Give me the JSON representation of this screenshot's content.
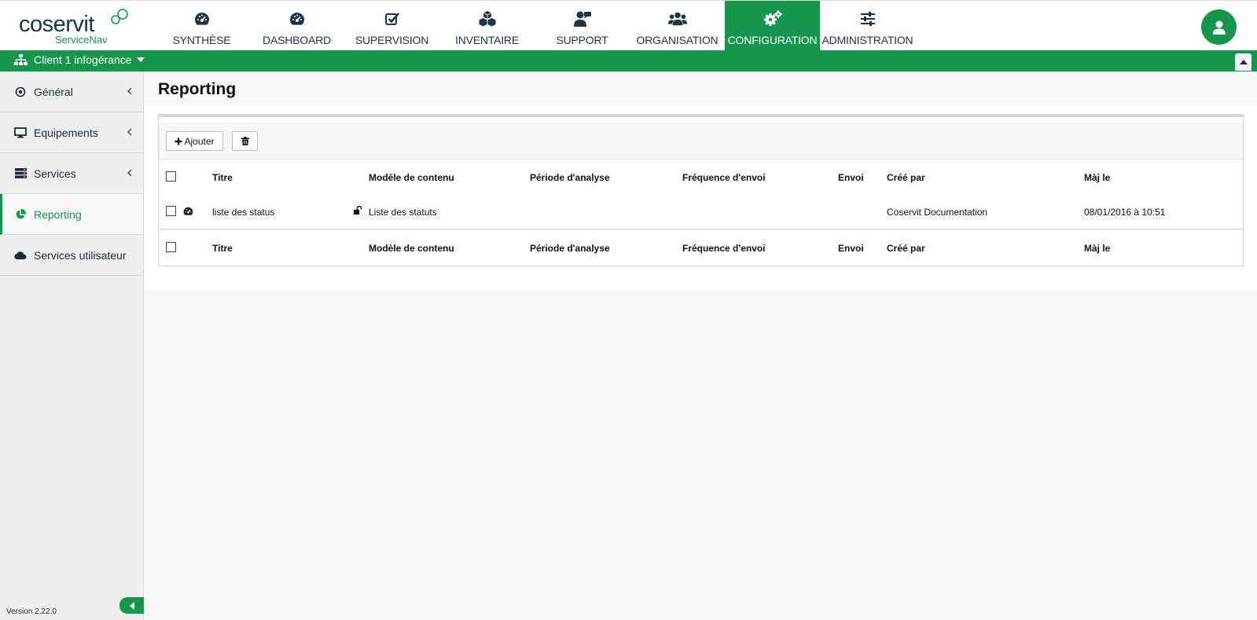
{
  "brand": {
    "name": "coservit",
    "product": "ServiceNav"
  },
  "nav": {
    "items": [
      {
        "label": "SYNTHÈSE",
        "icon": "gauge-icon"
      },
      {
        "label": "DASHBOARD",
        "icon": "gauge-icon"
      },
      {
        "label": "SUPERVISION",
        "icon": "check-square-icon"
      },
      {
        "label": "INVENTAIRE",
        "icon": "cubes-icon"
      },
      {
        "label": "SUPPORT",
        "icon": "support-agent-icon"
      },
      {
        "label": "ORGANISATION",
        "icon": "users-icon"
      },
      {
        "label": "CONFIGURATION",
        "icon": "gears-icon",
        "active": true
      },
      {
        "label": "ADMINISTRATION",
        "icon": "sliders-icon"
      }
    ]
  },
  "client": {
    "label": "Client 1 infogérance"
  },
  "sidebar": {
    "items": [
      {
        "label": "Général",
        "icon": "dot-circle-icon"
      },
      {
        "label": "Equipements",
        "icon": "monitor-icon"
      },
      {
        "label": "Services",
        "icon": "server-icon"
      },
      {
        "label": "Reporting",
        "icon": "pie-chart-icon",
        "active": true
      },
      {
        "label": "Services utilisateur",
        "icon": "cloud-icon"
      }
    ],
    "version": "Version 2.22.0"
  },
  "page": {
    "title": "Reporting"
  },
  "toolbar": {
    "add_label": "Ajouter"
  },
  "table": {
    "columns": [
      "Titre",
      "Modèle de contenu",
      "Période d'analyse",
      "Fréquence d'envoi",
      "Envoi",
      "Créé par",
      "Màj le"
    ],
    "rows": [
      {
        "titre": "liste des status",
        "modele": "Liste des statuts",
        "periode": "",
        "frequence": "",
        "envoi": "",
        "cree_par": "Coservit Documentation",
        "maj_le": "08/01/2016 à 10:51"
      }
    ]
  },
  "colors": {
    "brand_green": "#16964d",
    "brand_dark": "#1b3547"
  }
}
